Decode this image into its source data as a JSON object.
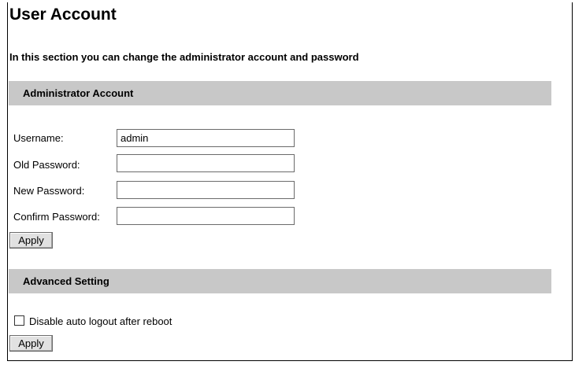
{
  "page": {
    "title": "User Account",
    "intro": "In this section you can change the administrator account and password"
  },
  "admin_section": {
    "header": "Administrator Account",
    "fields": [
      {
        "label": "Username:",
        "value": "admin",
        "placeholder": ""
      },
      {
        "label": "Old Password:",
        "value": "",
        "placeholder": ""
      },
      {
        "label": "New Password:",
        "value": "",
        "placeholder": ""
      },
      {
        "label": "Confirm Password:",
        "value": "",
        "placeholder": ""
      }
    ],
    "apply_label": "Apply"
  },
  "advanced_section": {
    "header": "Advanced Setting",
    "checkbox_label": "Disable auto logout after reboot",
    "checkbox_checked": false,
    "apply_label": "Apply"
  }
}
